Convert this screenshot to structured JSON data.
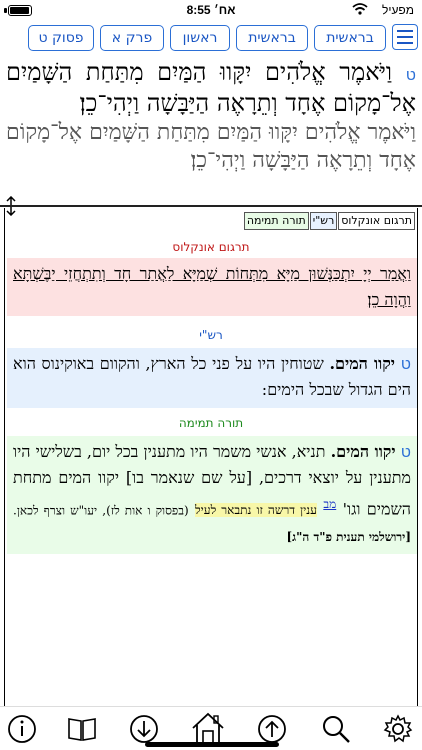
{
  "status": {
    "carrier": "מפעיל",
    "time": "8:55 אח׳"
  },
  "toolbar": {
    "buttons": [
      "בראשית",
      "בראשית",
      "ראשון",
      "פרק א",
      "פסוק ט"
    ]
  },
  "verse": {
    "marker": "ט",
    "line1": "וַיֹּאמֶר אֱלֹהִים יִקָּווּ הַמַּיִם מִתַּחַת הַשָּׁמַיִם אֶל־מָקוֹם אֶחָד וְתֵרָאֶה הַיַּבָּשָׁה וַיְהִי־כֵן׃",
    "line2": "וַיֹּאמֶר אֱלֹהִים יִקָּווּ הַמַּיִם מִתַּחַת הַשָּׁמַיִם אֶל־מָקוֹם אֶחָד וְתֵרָאֶה הַיַּבָּשָׁה וַיְהִי־כֵן׃"
  },
  "tabs": [
    "תרגום אונקלוס",
    "רש\"י",
    "תורה תמימה"
  ],
  "onkelos": {
    "title": "תרגום אונקלוס",
    "text": "וַאֲמַר יְיָ יִתְכַּנְּשׁוּן מַיָּא מִתְּחוֹת שְׁמַיָּא לַאֲתַר חָד וְתִתְחֲזֵי יַבֶּשְׁתָּא וַהֲוָה כֵן׃"
  },
  "rashi": {
    "title": "רש\"י",
    "marker": "ט",
    "lemma": "יקוו המים.",
    "text": "שטוחין היו על פני כל הארץ, והקוום באוקינוס הוא הים הגדול שבכל הימים:"
  },
  "torah_temima": {
    "title": "תורה תמימה",
    "marker": "ט",
    "lemma": "יקוו המים.",
    "text1": "תניא, אנשי משמר היו מתענין בכל יום, בשלישי היו מתענין על יוצאי דרכים, [על שם שנאמר בו] יקוו המים מתחת השמים וגו'",
    "link": "מב",
    "yellow": "ענין דרשה זו נתבאר לעיל",
    "small": "(בפסוק ו אות לז), יעו\"ש וצרף לכאן.",
    "source": "[ירושלמי תענית פ\"ד ה\"ג]"
  },
  "bottom_icons": [
    "info-icon",
    "book-icon",
    "download-icon",
    "home-icon",
    "upload-icon",
    "search-icon",
    "gear-icon"
  ]
}
